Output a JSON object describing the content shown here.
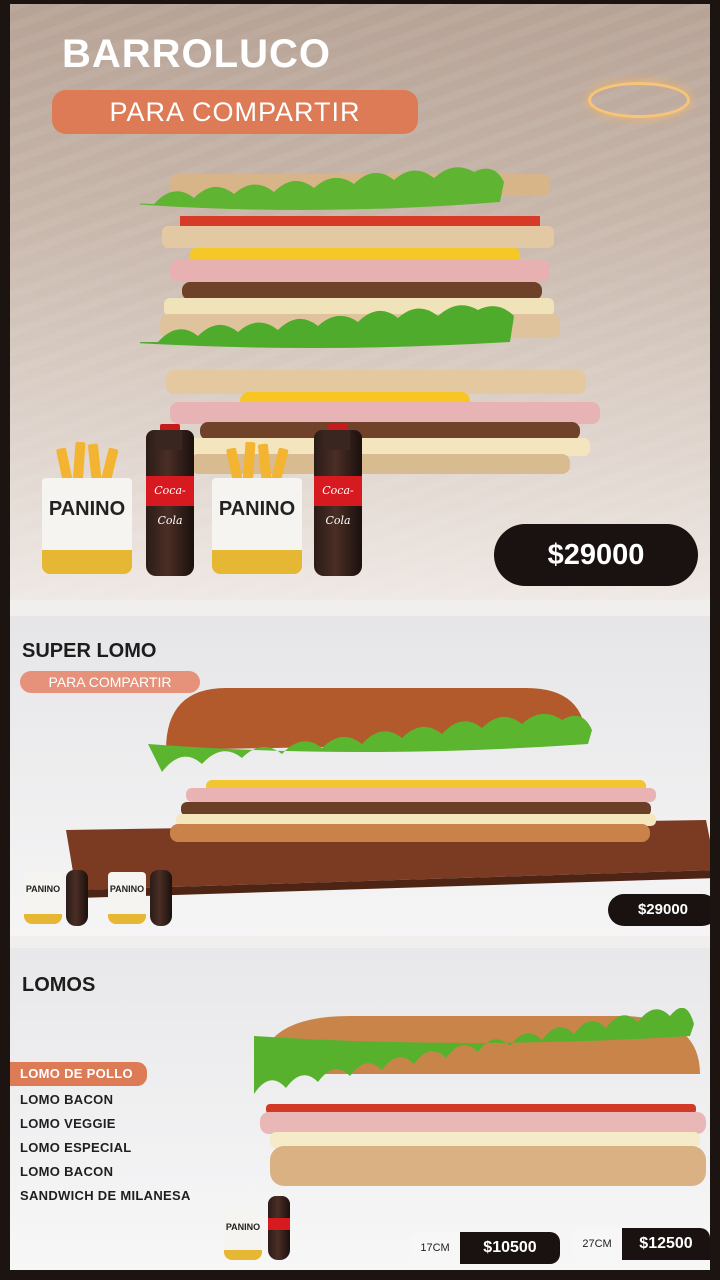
{
  "barroluco": {
    "title": "BARROLUCO",
    "tag": "PARA COMPARTIR",
    "price": "$29000",
    "combo_brand": "PANINO",
    "drink_label": "Coca-Cola"
  },
  "super_lomo": {
    "title": "SUPER LOMO",
    "tag": "PARA COMPARTIR",
    "price": "$29000",
    "combo_brand": "PANINO"
  },
  "lomos": {
    "title": "LOMOS",
    "items": [
      {
        "label": "LOMO DE POLLO",
        "selected": true
      },
      {
        "label": "LOMO BACON",
        "selected": false
      },
      {
        "label": "LOMO VEGGIE",
        "selected": false
      },
      {
        "label": "LOMO ESPECIAL",
        "selected": false
      },
      {
        "label": "LOMO BACON",
        "selected": false
      },
      {
        "label": "SANDWICH DE MILANESA",
        "selected": false
      }
    ],
    "sizes": [
      {
        "size": "17CM",
        "price": "$10500"
      },
      {
        "size": "27CM",
        "price": "$12500"
      }
    ],
    "combo_brand": "PANINO"
  },
  "colors": {
    "accent_orange": "#dc7b55",
    "price_badge": "#1a1210",
    "coke_red": "#d71920"
  },
  "icons": [
    "fries-bag-icon",
    "soda-bottle-icon",
    "sandwich-image"
  ]
}
